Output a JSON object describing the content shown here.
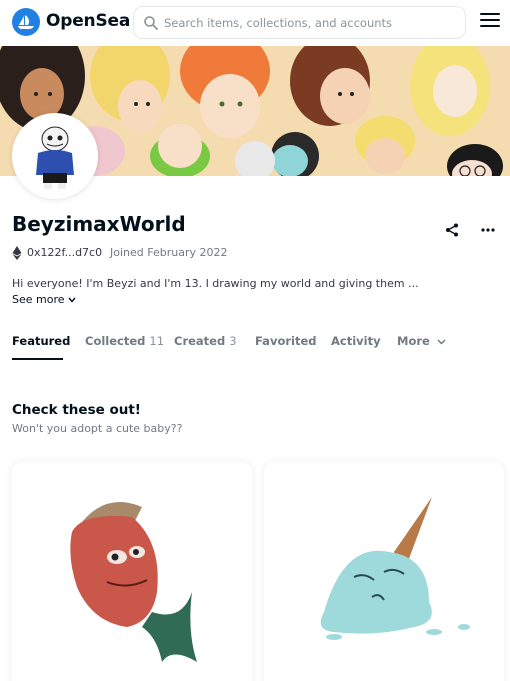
{
  "header": {
    "brand": "OpenSea",
    "logo_icon": "opensea-logo-icon",
    "search_placeholder": "Search items, collections, and accounts",
    "menu_icon": "hamburger-menu-icon"
  },
  "profile": {
    "name": "BeyzimaxWorld",
    "address": "0x122f...d7c0",
    "joined": "Joined February 2022",
    "bio": "Hi everyone! I'm Beyzi and I'm 13. I drawing my world and giving them ...",
    "see_more": "See more",
    "share_icon": "share-icon",
    "more_icon": "more-options-icon"
  },
  "tabs": [
    {
      "label": "Featured",
      "count": ""
    },
    {
      "label": "Collected",
      "count": "11"
    },
    {
      "label": "Created",
      "count": "3"
    },
    {
      "label": "Favorited",
      "count": ""
    },
    {
      "label": "Activity",
      "count": ""
    },
    {
      "label": "More",
      "count": ""
    }
  ],
  "featured": {
    "title": "Check these out!",
    "subtitle": "Won't you adopt a cute baby??"
  },
  "colors": {
    "brand_blue": "#2081e2",
    "text_primary": "#04111d",
    "text_secondary": "#707a83"
  }
}
